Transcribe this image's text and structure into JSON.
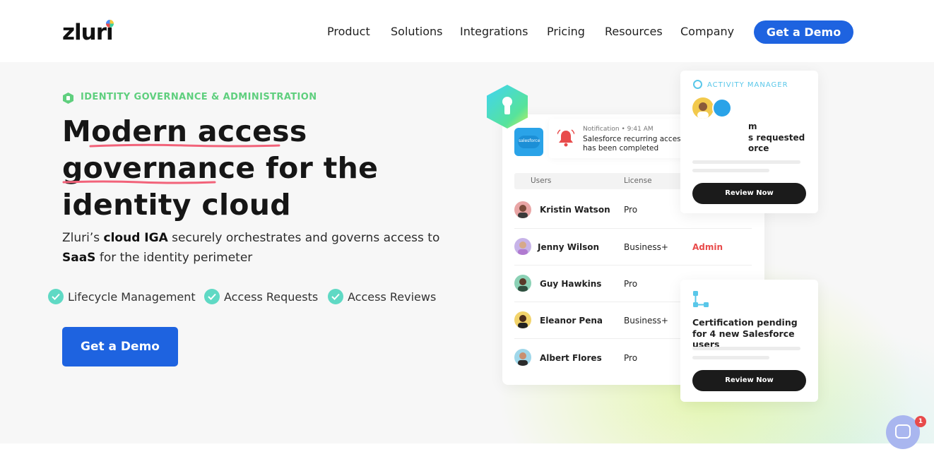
{
  "brand": {
    "logo_text": "zluri"
  },
  "nav": {
    "items": [
      "Product",
      "Solutions",
      "Integrations",
      "Pricing",
      "Resources",
      "Company"
    ],
    "cta_label": "Get a Demo"
  },
  "hero": {
    "eyebrow": "IDENTITY GOVERNANCE & ADMINISTRATION",
    "headline_line1": "Modern access",
    "headline_line2": "governance for the",
    "headline_line3": "identity cloud",
    "sub_1": "Zluri’s ",
    "sub_bold1": "cloud IGA",
    "sub_2": " securely orchestrates and governs access to",
    "sub_bold2": "SaaS",
    "sub_3": " for the identity perimeter",
    "features": [
      "Lifecycle Management",
      "Access Requests",
      "Access Reviews"
    ],
    "cta_label": "Get a Demo"
  },
  "mockup": {
    "salesforce_label": "salesforce",
    "notification": {
      "meta": "Notification • 9:41 AM",
      "message": "Salesforce recurring access certification has been completed"
    },
    "table": {
      "headers": [
        "Users",
        "License"
      ],
      "rows": [
        {
          "name": "Kristin Watson",
          "license": "Pro",
          "role": ""
        },
        {
          "name": "Jenny Wilson",
          "license": "Business+",
          "role": "Admin"
        },
        {
          "name": "Guy Hawkins",
          "license": "Pro",
          "role": ""
        },
        {
          "name": "Eleanor Pena",
          "license": "Business+",
          "role": ""
        },
        {
          "name": "Albert Flores",
          "license": "Pro",
          "role": ""
        }
      ]
    },
    "activity": {
      "title": "ACTIVITY MANAGER",
      "line1": "m",
      "line2": "s requested",
      "line3": "orce",
      "button": "Review Now"
    },
    "certification": {
      "text": "Certification pending for 4 new Salesforce users",
      "button": "Review Now"
    }
  },
  "chat": {
    "badge": "1"
  },
  "colors": {
    "primary": "#1e63e0",
    "green": "#5fcf7e",
    "teal": "#5fd9c4",
    "red": "#e84b4b",
    "dark": "#1b1b1b"
  }
}
